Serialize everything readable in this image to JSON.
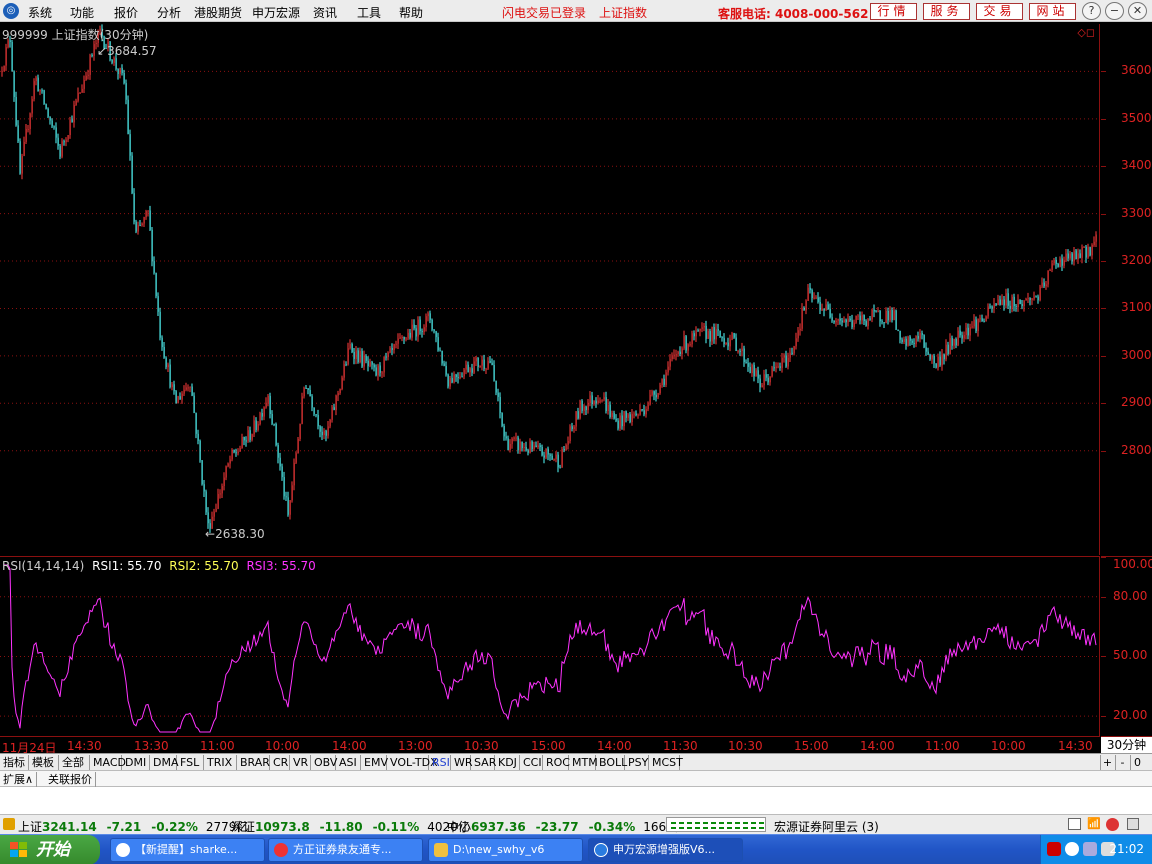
{
  "menu": {
    "items": [
      "系统",
      "功能",
      "报价",
      "分析",
      "港股期货",
      "申万宏源",
      "资讯",
      "工具",
      "帮助"
    ],
    "status_login": "闪电交易已登录",
    "status_index": "上证指数",
    "hotline": "客服电话: 4008-000-562",
    "buttons": [
      "行情",
      "服务",
      "交易",
      "网站"
    ],
    "window_controls": [
      "?",
      "−",
      "❐",
      "✕"
    ]
  },
  "chart": {
    "title": "999999 上证指数(30分钟)",
    "high_label": "3684.57",
    "low_label": "2638.30",
    "price_ticks": [
      "3600",
      "3500",
      "3400",
      "3300",
      "3200",
      "3100",
      "3000",
      "2900",
      "2800"
    ],
    "corner_icons": "◇◻"
  },
  "rsi": {
    "label": "RSI(14,14,14)",
    "rsi1": "RSI1: 55.70",
    "rsi2": "RSI2: 55.70",
    "rsi3": "RSI3: 55.70",
    "ticks": [
      "100.00",
      "80.00",
      "50.00",
      "20.00"
    ]
  },
  "chart_data": {
    "type": "candlestick",
    "series": "上证指数 30分钟",
    "high": 3684.57,
    "low": 2638.3,
    "ylim": [
      2580,
      3700
    ],
    "last_rsi": 55.7,
    "rsi_ylim": [
      10,
      100
    ],
    "anchors": [
      [
        0,
        3600
      ],
      [
        10,
        3670
      ],
      [
        20,
        3380
      ],
      [
        35,
        3590
      ],
      [
        60,
        3430
      ],
      [
        85,
        3590
      ],
      [
        100,
        3684.57
      ],
      [
        125,
        3570
      ],
      [
        135,
        3250
      ],
      [
        148,
        3300
      ],
      [
        160,
        3050
      ],
      [
        175,
        2900
      ],
      [
        190,
        2950
      ],
      [
        208,
        2638.3
      ],
      [
        230,
        2780
      ],
      [
        255,
        2850
      ],
      [
        268,
        2920
      ],
      [
        288,
        2660
      ],
      [
        305,
        2950
      ],
      [
        325,
        2820
      ],
      [
        350,
        3020
      ],
      [
        375,
        2960
      ],
      [
        405,
        3040
      ],
      [
        430,
        3080
      ],
      [
        448,
        2950
      ],
      [
        470,
        2980
      ],
      [
        490,
        2990
      ],
      [
        505,
        2820
      ],
      [
        535,
        2800
      ],
      [
        560,
        2780
      ],
      [
        580,
        2890
      ],
      [
        600,
        2920
      ],
      [
        615,
        2860
      ],
      [
        640,
        2880
      ],
      [
        660,
        2940
      ],
      [
        680,
        3020
      ],
      [
        705,
        3050
      ],
      [
        735,
        3030
      ],
      [
        760,
        2940
      ],
      [
        790,
        3000
      ],
      [
        808,
        3130
      ],
      [
        830,
        3090
      ],
      [
        850,
        3070
      ],
      [
        870,
        3080
      ],
      [
        893,
        3090
      ],
      [
        900,
        3020
      ],
      [
        920,
        3040
      ],
      [
        935,
        2980
      ],
      [
        960,
        3050
      ],
      [
        985,
        3080
      ],
      [
        1000,
        3120
      ],
      [
        1020,
        3110
      ],
      [
        1040,
        3130
      ],
      [
        1055,
        3200
      ],
      [
        1080,
        3210
      ],
      [
        1097,
        3241
      ]
    ]
  },
  "time_axis": {
    "labels": [
      "11月24日",
      "14:30",
      "13:30",
      "11:00",
      "10:00",
      "14:00",
      "13:00",
      "10:30",
      "15:00",
      "14:00",
      "11:30",
      "10:30",
      "15:00",
      "14:00",
      "11:00",
      "10:00",
      "14:30"
    ],
    "period": "30分钟"
  },
  "indicators": {
    "tabs": [
      "指标",
      "模板",
      "全部",
      "MACD",
      "DMI",
      "DMA",
      "FSL",
      "TRIX",
      "BRAR",
      "CR",
      "VR",
      "OBV",
      "ASI",
      "EMV",
      "VOL-TDX",
      "RSI",
      "WR",
      "SAR",
      "KDJ",
      "CCI",
      "ROC",
      "MTM",
      "BOLL",
      "PSY",
      "MCST"
    ],
    "active": "RSI",
    "controls": [
      "+",
      "-",
      "0"
    ]
  },
  "expand_tabs": [
    "扩展∧",
    "关联报价"
  ],
  "index_strip": {
    "sh": {
      "name": "上证",
      "value": "3241.14",
      "change": "-7.21",
      "pct": "-0.22%",
      "amount": "2779亿"
    },
    "sz": {
      "name": "深证",
      "value": "10973.8",
      "change": "-11.80",
      "pct": "-0.11%",
      "amount": "4020亿"
    },
    "zx": {
      "name": "中小",
      "value": "6937.36",
      "change": "-23.77",
      "pct": "-0.34%",
      "amount": "1668亿"
    },
    "broker": "宏源证券阿里云 (3)"
  },
  "taskbar": {
    "start": "开始",
    "tasks": [
      "【新提醒】sharke...",
      "方正证券泉友通专...",
      "D:\\new_swhy_v6",
      "申万宏源增强版V6..."
    ],
    "clock": "21:02"
  },
  "colors": {
    "up": "#ff3b3b",
    "down": "#54ffff",
    "rsi_line": "#ff33ff",
    "grid": "#8b1010",
    "axis_text": "#dd2222",
    "rsi2": "#ffff55"
  }
}
